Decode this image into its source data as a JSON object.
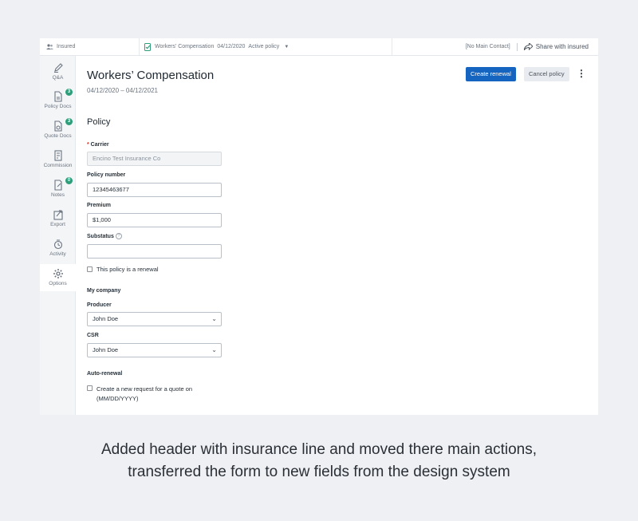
{
  "topbar": {
    "insured_label": "Insured",
    "policy_line": "Workers' Compensation",
    "policy_date": "04/12/2020",
    "policy_status": "Active policy",
    "main_contact": "[No Main Contact]",
    "share_label": "Share with insured"
  },
  "sidebar": {
    "items": [
      {
        "label": "Q&A"
      },
      {
        "label": "Policy Docs",
        "badge": "3"
      },
      {
        "label": "Quote Docs",
        "badge": "3"
      },
      {
        "label": "Commission"
      },
      {
        "label": "Notes",
        "badge": "0"
      },
      {
        "label": "Export"
      },
      {
        "label": "Activity"
      },
      {
        "label": "Options"
      }
    ]
  },
  "header": {
    "title": "Workers’ Compensation",
    "dates": "04/12/2020 – 04/12/2021",
    "create_renewal": "Create renewal",
    "cancel_policy": "Cancel policy"
  },
  "form": {
    "section_title": "Policy",
    "carrier_label": "Carrier",
    "carrier_value": "Encino Test Insurance Co",
    "policy_number_label": "Policy number",
    "policy_number_value": "12345463677",
    "premium_label": "Premium",
    "premium_value": "$1,000",
    "substatus_label": "Substatus",
    "substatus_value": "",
    "renewal_checkbox": "This policy is a renewal",
    "my_company_title": "My company",
    "producer_label": "Producer",
    "producer_value": "John Doe",
    "csr_label": "CSR",
    "csr_value": "John Doe",
    "auto_renewal_title": "Auto-renewal",
    "auto_renewal_checkbox_line1": "Create a new request for a quote on",
    "auto_renewal_checkbox_line2": "(MM/DD/YYYY)"
  },
  "caption": {
    "line1": "Added header with insurance line and moved there main actions,",
    "line2": "transferred the form to new fields from the design system"
  },
  "colors": {
    "primary": "#1565c0",
    "badge": "#2e9e7a",
    "required": "#d93025"
  }
}
